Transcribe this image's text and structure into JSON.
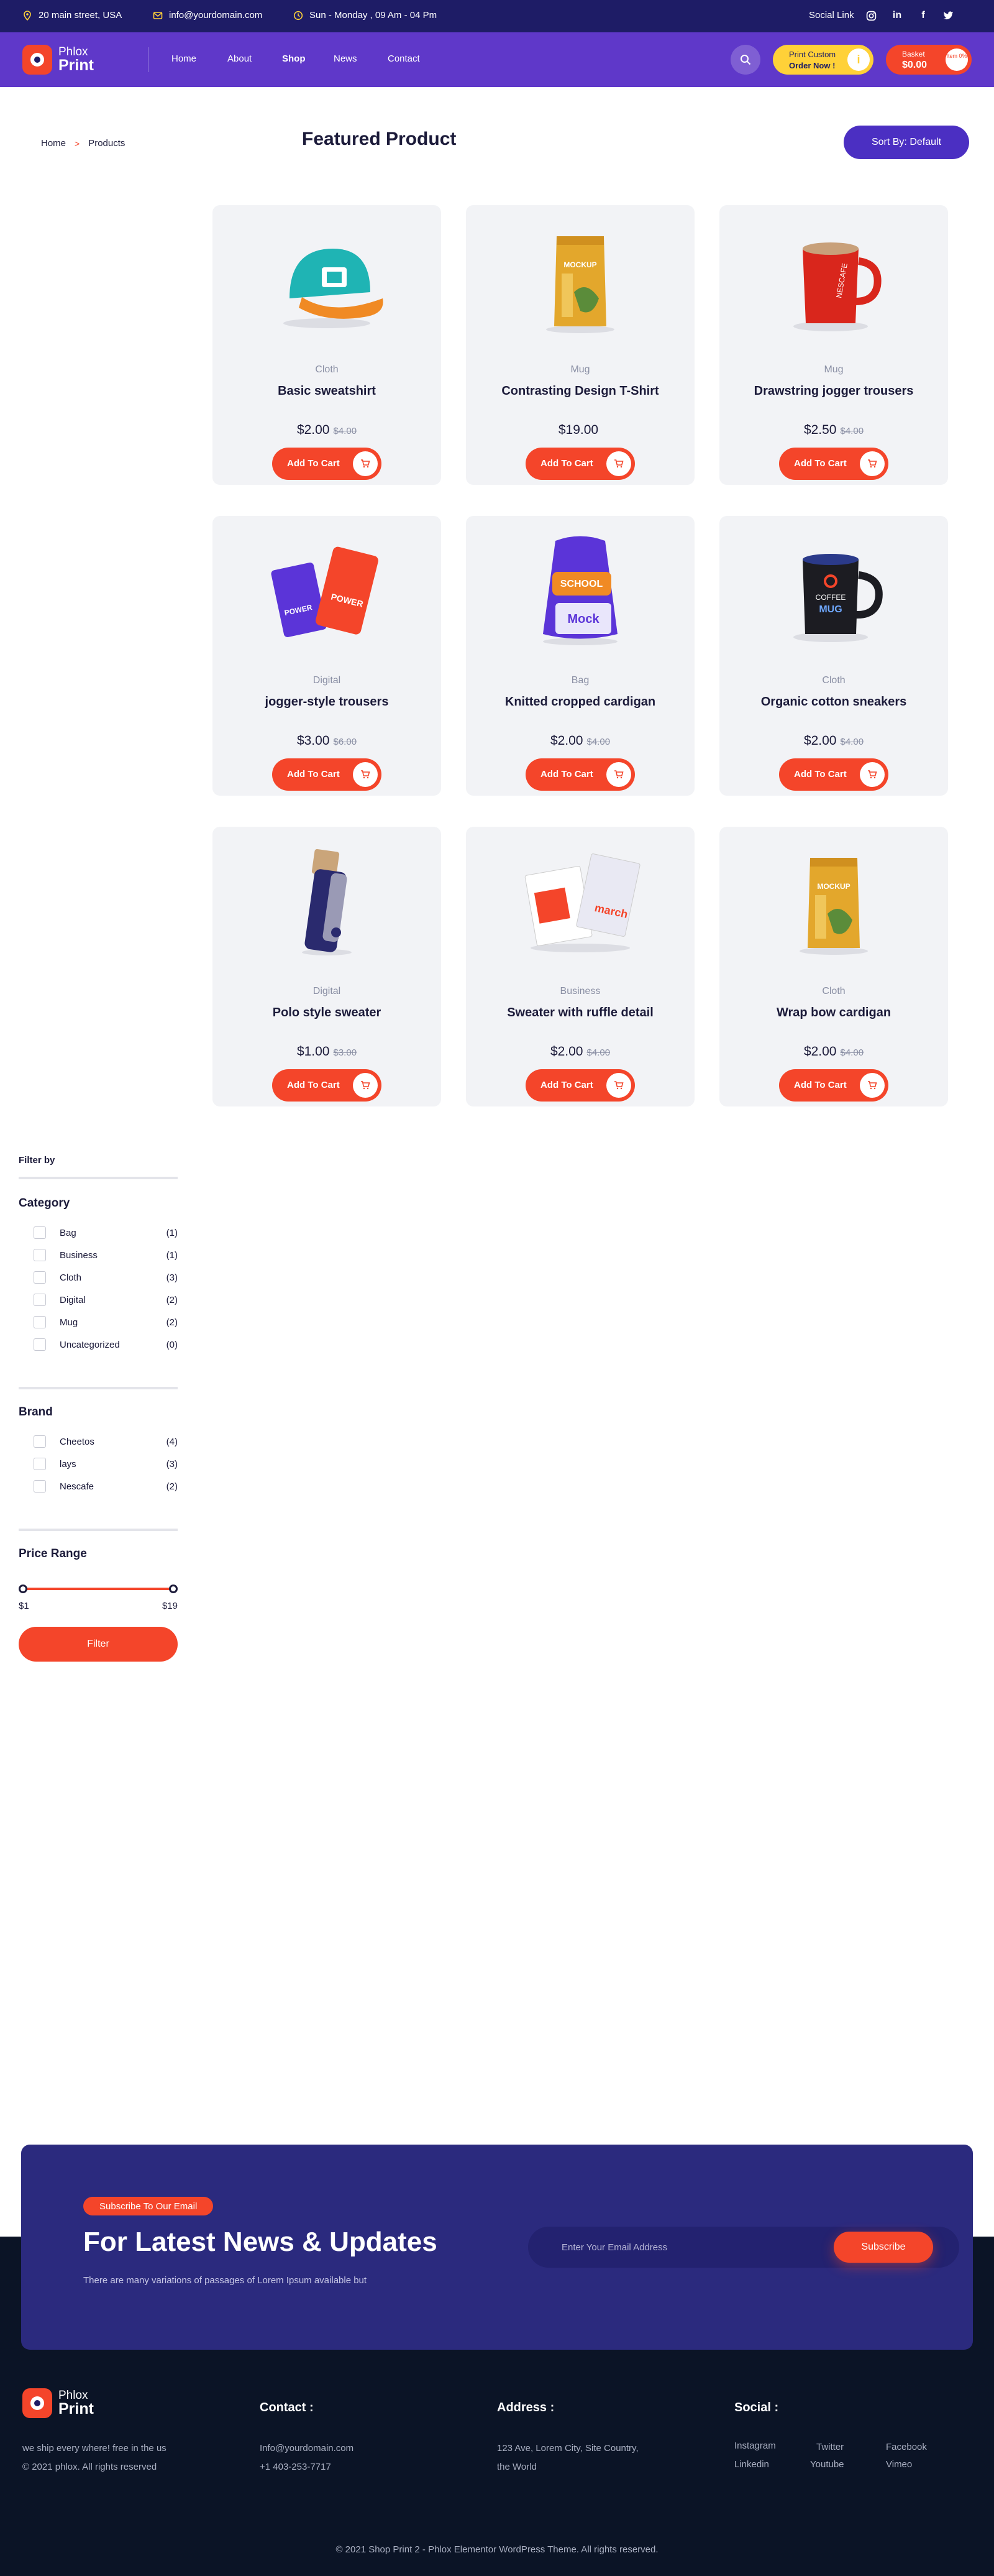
{
  "topbar": {
    "address": "20 main street, USA",
    "email": "info@yourdomain.com",
    "hours": "Sun - Monday , 09 Am - 04 Pm",
    "social_label": "Social Link"
  },
  "header": {
    "logo_line1": "Phlox",
    "logo_line2": "Print",
    "nav": [
      "Home",
      "About",
      "Shop",
      "News",
      "Contact"
    ],
    "active_nav": "Shop",
    "print_custom": "Print Custom",
    "order_now": "Order Now !",
    "basket_label": "Basket",
    "basket_total": "$0.00",
    "basket_items": "Item 0%"
  },
  "toolbar": {
    "breadcrumb": [
      "Home",
      "Products"
    ],
    "title": "Featured Product",
    "sort_label": "Sort By: Default"
  },
  "products": [
    {
      "category": "Cloth",
      "name": "Basic sweatshirt",
      "price": "$2.00",
      "old_price": "$4.00",
      "image": "cap"
    },
    {
      "category": "Mug",
      "name": "Contrasting Design T-Shirt",
      "price": "$19.00",
      "old_price": "",
      "image": "bag-pouch"
    },
    {
      "category": "Mug",
      "name": "Drawstring jogger trousers",
      "price": "$2.50",
      "old_price": "$4.00",
      "image": "red-mug"
    },
    {
      "category": "Digital",
      "name": "jogger-style trousers",
      "price": "$3.00",
      "old_price": "$6.00",
      "image": "power-bank"
    },
    {
      "category": "Bag",
      "name": "Knitted cropped cardigan",
      "price": "$2.00",
      "old_price": "$4.00",
      "image": "backpack"
    },
    {
      "category": "Cloth",
      "name": "Organic cotton sneakers",
      "price": "$2.00",
      "old_price": "$4.00",
      "image": "black-mug"
    },
    {
      "category": "Digital",
      "name": "Polo style sweater",
      "price": "$1.00",
      "old_price": "$3.00",
      "image": "usb-drive"
    },
    {
      "category": "Business",
      "name": "Sweater with ruffle detail",
      "price": "$2.00",
      "old_price": "$4.00",
      "image": "notebooks"
    },
    {
      "category": "Cloth",
      "name": "Wrap bow cardigan",
      "price": "$2.00",
      "old_price": "$4.00",
      "image": "bag-pouch"
    }
  ],
  "add_to_cart_label": "Add To Cart",
  "sidebar": {
    "filter_by": "Filter by",
    "category_title": "Category",
    "categories": [
      {
        "name": "Bag",
        "count": "(1)"
      },
      {
        "name": "Business",
        "count": "(1)"
      },
      {
        "name": "Cloth",
        "count": "(3)"
      },
      {
        "name": "Digital",
        "count": "(2)"
      },
      {
        "name": "Mug",
        "count": "(2)"
      },
      {
        "name": "Uncategorized",
        "count": "(0)"
      }
    ],
    "brand_title": "Brand",
    "brands": [
      {
        "name": "Cheetos",
        "count": "(4)"
      },
      {
        "name": "lays",
        "count": "(3)"
      },
      {
        "name": "Nescafe",
        "count": "(2)"
      }
    ],
    "price_title": "Price Range",
    "price_min": "$1",
    "price_max": "$19",
    "filter_button": "Filter"
  },
  "newsletter": {
    "badge": "Subscribe To Our Email",
    "title": "For Latest News & Updates",
    "description": "There are many variations of passages of Lorem Ipsum available but",
    "email_placeholder": "Enter Your Email Address",
    "subscribe_button": "Subscribe"
  },
  "footer": {
    "logo_line1": "Phlox",
    "logo_line2": "Print",
    "tagline": "we ship every where! free in the us",
    "rights": "© 2021 phlox. All rights reserved",
    "contact_title": "Contact :",
    "contact_email": "Info@yourdomain.com",
    "contact_phone": "+1 403-253-7717",
    "address_title": "Address :",
    "address_line1": "123 Ave, Lorem City, Site Country,",
    "address_line2": "the World",
    "social_title": "Social :",
    "social_links": [
      "Instagram",
      "Twitter",
      "Facebook",
      "Linkedin",
      "Youtube",
      "Vimeo"
    ],
    "copyright": "© 2021 Shop Print 2 - Phlox Elementor WordPress Theme. All rights reserved."
  },
  "colors": {
    "primary": "#5f38c9",
    "dark": "#1e1c66",
    "accent": "#f4452a",
    "yellow": "#ffd138",
    "card_bg": "#f2f3f6"
  }
}
